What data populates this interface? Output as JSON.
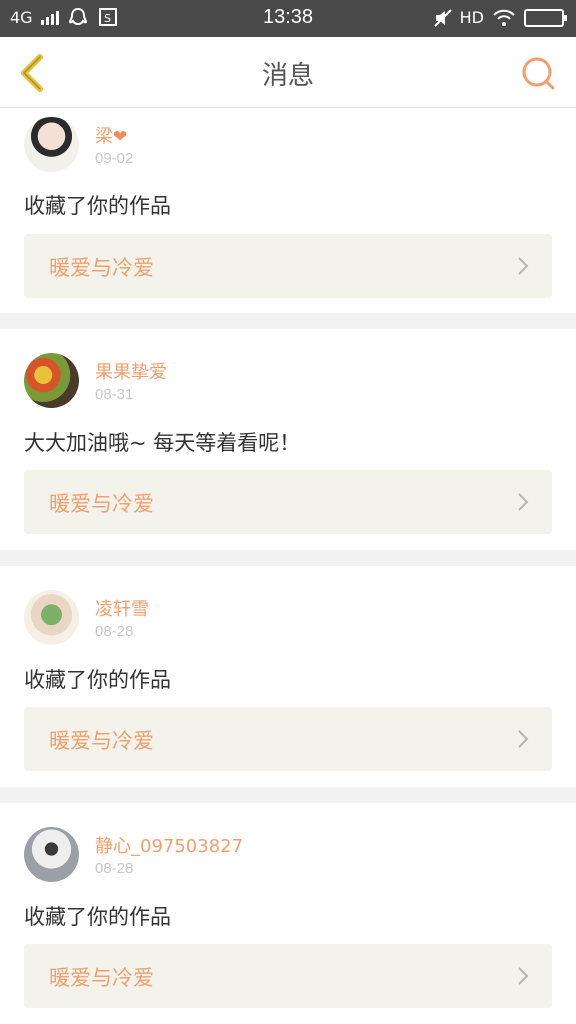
{
  "status_bar": {
    "network": "4G",
    "time": "13:38",
    "hd": "HD"
  },
  "header": {
    "title": "消息"
  },
  "colors": {
    "accent": "#f0a070",
    "back_icon": "#e8c13a",
    "header_bg": "#ffffff",
    "status_bg": "#4a4a4a",
    "card_bg": "#f3f3ec"
  },
  "messages": [
    {
      "name": "梁",
      "badge": "❤",
      "date": "09-02",
      "text": "收藏了你的作品",
      "work": "暖爱与冷爱"
    },
    {
      "name": "果果挚爱",
      "date": "08-31",
      "text": "大大加油哦~ 每天等着看呢！",
      "work": "暖爱与冷爱"
    },
    {
      "name": "凌轩雪",
      "date": "08-28",
      "text": "收藏了你的作品",
      "work": "暖爱与冷爱"
    },
    {
      "name": "静心_097503827",
      "date": "08-28",
      "text": "收藏了你的作品",
      "work": "暖爱与冷爱"
    }
  ]
}
